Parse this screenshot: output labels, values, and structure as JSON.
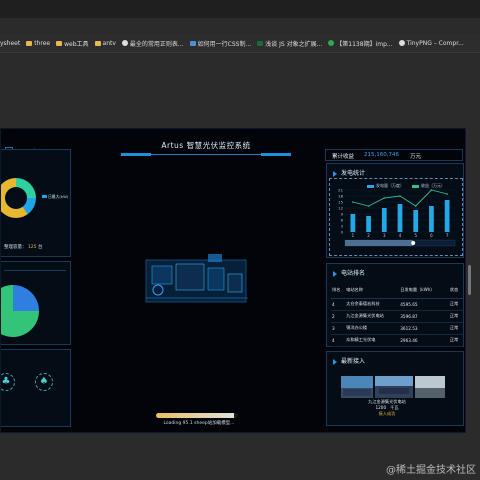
{
  "bookmarks": [
    {
      "label": "ysheet",
      "icon": "folder-icon"
    },
    {
      "label": "three",
      "icon": "folder-icon"
    },
    {
      "label": "web工具",
      "icon": "folder-icon"
    },
    {
      "label": "antv",
      "icon": "folder-icon"
    },
    {
      "label": "最全的常用正则表...",
      "icon": "wordpress-icon"
    },
    {
      "label": "如何用一行CSS制...",
      "icon": "page-icon"
    },
    {
      "label": "浅谈 JS 对象之扩展...",
      "icon": "green-s-icon"
    },
    {
      "label": "【第1138期】imp...",
      "icon": "wechat-icon"
    },
    {
      "label": "TinyPNG – Compr...",
      "icon": "tinypng-icon"
    }
  ],
  "dashboard": {
    "title": "Artus 智慧光伏监控系统",
    "left_top_value": "万度",
    "donut_label": "日最大(kW)",
    "capacity_label": "整理容量：",
    "capacity_value": "125",
    "capacity_unit": "台",
    "right_top_label": "累计收益",
    "right_top_value": "215,160,746",
    "right_top_unit": "万元",
    "loading_progress": 0.95,
    "loading_text": "Loading 95.1 sheep站加载模型..."
  },
  "chart_panel": {
    "title": "发电统计",
    "legend": [
      "发电量（万度）",
      "收益（万元）"
    ],
    "y_ticks": [
      "21",
      "18",
      "15",
      "12",
      "9",
      "6",
      "3",
      "0"
    ],
    "chart_data": {
      "type": "bar",
      "categories": [
        "1",
        "2",
        "3",
        "4",
        "5",
        "6",
        "7"
      ],
      "series": [
        {
          "name": "发电量（万度）",
          "values": [
            9,
            8,
            12,
            14,
            11,
            13,
            16
          ]
        }
      ],
      "line_series": {
        "name": "收益（万元）",
        "values": [
          15,
          13,
          17,
          18,
          13,
          21,
          19
        ]
      },
      "ylim": [
        0,
        21
      ]
    }
  },
  "table_panel": {
    "title": "电站排名",
    "headers": [
      "排名",
      "电站名称",
      "日发电量（kWh）",
      "状态"
    ],
    "rows": [
      [
        "4",
        "太仓余泰德宏科技",
        "4595.65",
        "正常"
      ],
      [
        "2",
        "九江金源集光伏电站",
        "3596.87",
        "正常"
      ],
      [
        "3",
        "锦洋办公楼",
        "3612.53",
        "正常"
      ],
      [
        "4",
        "众和精工光伏电",
        "2963.46",
        "正常"
      ]
    ]
  },
  "news_panel": {
    "title": "最新接入",
    "caption_line1": "九江金源集光伏电站",
    "caption_line2a": "1200",
    "caption_line2b": "千瓦",
    "status": "接入成功"
  },
  "watermark": "@稀土掘金技术社区",
  "colors": {
    "accent": "#1f8fe0",
    "bar": "#23a9e8",
    "line": "#2fc08a"
  }
}
